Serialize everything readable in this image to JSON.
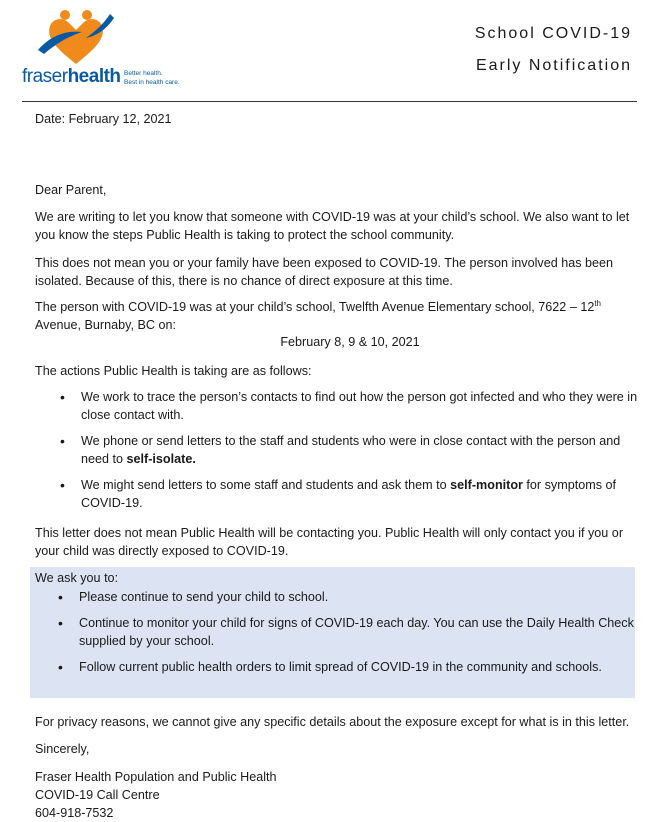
{
  "header": {
    "brand_bold": "fraser",
    "brand_rest": "health",
    "tagline_1": "Better health.",
    "tagline_2": "Best in health care.",
    "title_line1": "School COVID-19",
    "title_line2": "Early Notification"
  },
  "date": "Date: February 12, 2021",
  "greeting": "Dear Parent,",
  "para1": "We are writing to let you know that someone with COVID-19 was at your child’s school. We also want to let you know the steps Public Health is taking to protect the school community.",
  "para2": "This does not mean you or your family have been exposed to COVID-19. The person involved has been isolated. Because of this, there is no chance of direct exposure at this time.",
  "para3_before": "The person with COVID-19 was at your child’s school, Twelfth Avenue Elementary school, 7622 – 12",
  "para3_sup": "th",
  "para3_after": " Avenue, Burnaby, BC on:",
  "exposure_dates": "February 8, 9 & 10, 2021",
  "actions_intro": "The actions Public Health is taking are as follows:",
  "actions": [
    {
      "text": "We work to trace the person’s contacts to find out how the person got infected and who they were in close contact with."
    },
    {
      "before": "We phone or send letters to the staff and students who were in close contact with the person and need to ",
      "bold": "self-isolate.",
      "after": ""
    },
    {
      "before": "We might send letters to some staff and students and ask them to ",
      "bold": "self-monitor",
      "after": " for symptoms of COVID-19."
    }
  ],
  "para4": "This letter does not mean Public Health will be contacting you. Public Health will only contact you if you or your child was directly exposed to COVID-19.",
  "ask": {
    "intro": "We ask you to:",
    "items": [
      "Please continue to send your child to school.",
      "Continue to monitor your child for signs of COVID-19 each day.  You can use the Daily Health Check supplied by your school.",
      "Follow current public health orders to limit spread of COVID-19 in the community and schools."
    ]
  },
  "privacy": "For privacy reasons, we cannot give any specific details about the exposure except for what is in this letter.",
  "closing": "Sincerely,",
  "signature": [
    "Fraser Health Population and Public Health",
    "COVID-19 Call Centre",
    "604-918-7532"
  ],
  "colors": {
    "brand_blue": "#0a5aa3",
    "brand_orange": "#f08a1c",
    "box_bg": "#dce3f2"
  }
}
